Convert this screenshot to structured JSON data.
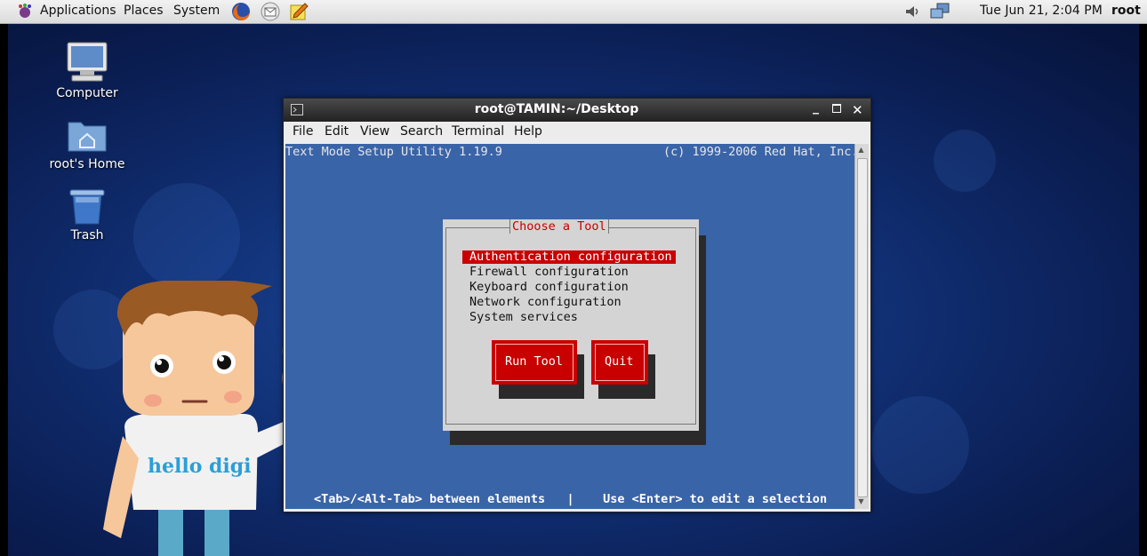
{
  "panel": {
    "menus": [
      "Applications",
      "Places",
      "System"
    ],
    "clock": "Tue Jun 21,  2:04 PM",
    "user": "root",
    "icons": [
      "gnome-foot-icon",
      "firefox-icon",
      "mail-icon",
      "notes-icon",
      "volume-icon",
      "network-icon"
    ]
  },
  "desktop": {
    "icons": [
      {
        "label": "Computer",
        "icon": "computer-icon"
      },
      {
        "label": "root's Home",
        "icon": "home-folder-icon"
      },
      {
        "label": "Trash",
        "icon": "trash-icon"
      }
    ],
    "mascot_text": "hello digi"
  },
  "window": {
    "title": "root@TAMIN:~/Desktop",
    "menu": [
      "File",
      "Edit",
      "View",
      "Search",
      "Terminal",
      "Help"
    ],
    "controls": [
      "minimize",
      "maximize",
      "close"
    ]
  },
  "tui": {
    "header_left": "Text Mode Setup Utility 1.19.9",
    "header_right": "(c) 1999-2006 Red Hat, Inc.",
    "dialog_title": "Choose a Tool",
    "tools": [
      "Authentication configuration",
      "Firewall configuration",
      "Keyboard configuration",
      "Network configuration",
      "System services"
    ],
    "selected_index": 0,
    "buttons": [
      "Run Tool",
      "Quit"
    ],
    "footer": "<Tab>/<Alt-Tab> between elements   |    Use <Enter> to edit a selection"
  },
  "colors": {
    "terminal_bg": "#3a64a8",
    "selection": "#c80000",
    "dialog_bg": "#d4d4d4"
  }
}
